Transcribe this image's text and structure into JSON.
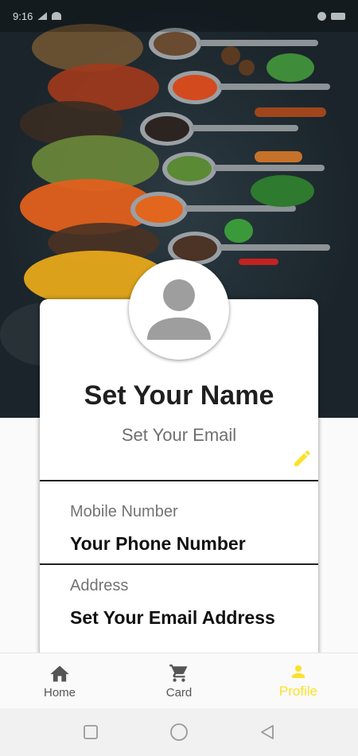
{
  "status_bar": {
    "time": "9:16"
  },
  "profile": {
    "name": "Set Your Name",
    "email": "Set Your Email"
  },
  "fields": [
    {
      "label": "Mobile Number",
      "value": "Your Phone Number"
    },
    {
      "label": "Address",
      "value": "Set Your Email Address"
    }
  ],
  "bottom_nav": {
    "items": [
      {
        "label": "Home",
        "icon": "home-icon"
      },
      {
        "label": "Card",
        "icon": "cart-icon"
      },
      {
        "label": "Profile",
        "icon": "person-icon",
        "active": true
      }
    ]
  },
  "colors": {
    "accent": "#fbe12a",
    "text_primary": "#1f1f1f",
    "text_secondary": "#737373"
  }
}
